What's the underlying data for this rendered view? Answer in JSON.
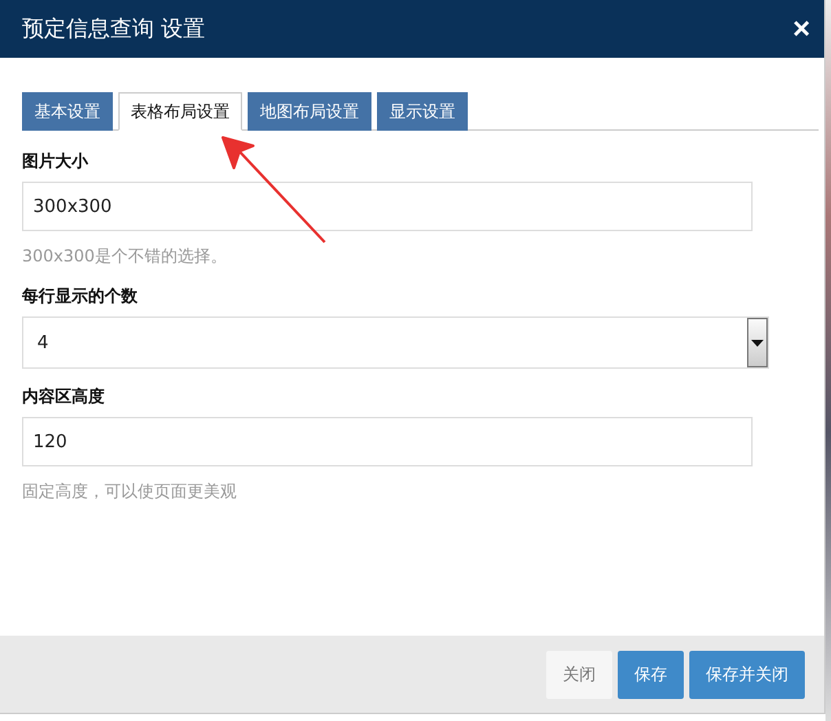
{
  "window": {
    "title": "预定信息查询 设置",
    "close_glyph": "×"
  },
  "tabs": [
    {
      "label": "基本设置",
      "selected": false
    },
    {
      "label": "表格布局设置",
      "selected": true
    },
    {
      "label": "地图布局设置",
      "selected": false
    },
    {
      "label": "显示设置",
      "selected": false
    }
  ],
  "fields": [
    {
      "kind": "text",
      "label": "图片大小",
      "value": "300x300",
      "hint": "300x300是个不错的选择。"
    },
    {
      "kind": "select",
      "label": "每行显示的个数",
      "value": "4"
    },
    {
      "kind": "text",
      "label": "内容区高度",
      "value": "120",
      "hint": "固定高度，可以使页面更美观"
    }
  ],
  "buttons": [
    {
      "label": "关闭",
      "kind": "secondary"
    },
    {
      "label": "保存",
      "kind": "primary"
    },
    {
      "label": "保存并关闭",
      "kind": "primary"
    }
  ]
}
